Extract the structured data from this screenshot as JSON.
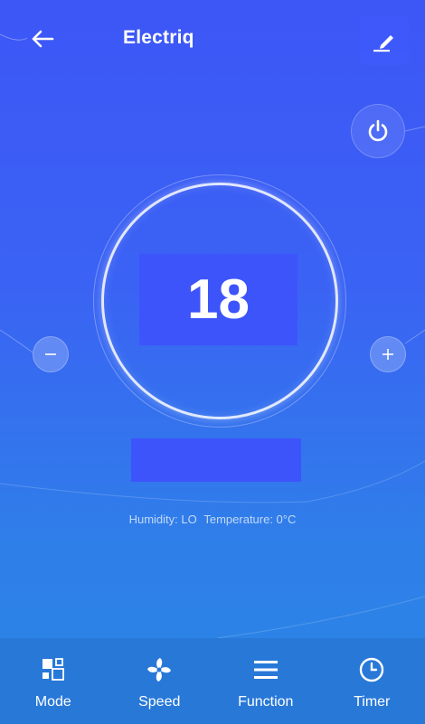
{
  "header": {
    "title": "Electriq"
  },
  "thermostat": {
    "temperature": "18"
  },
  "status": {
    "humidity": "Humidity: LO",
    "temperature": "Temperature: 0°C"
  },
  "nav": [
    {
      "label": "Mode",
      "icon": "mode-icon"
    },
    {
      "label": "Speed",
      "icon": "fan-icon"
    },
    {
      "label": "Function",
      "icon": "menu-icon"
    },
    {
      "label": "Timer",
      "icon": "clock-icon"
    }
  ],
  "colors": {
    "accent": "#3d54fb",
    "bottom_bar": "#2878d8"
  }
}
